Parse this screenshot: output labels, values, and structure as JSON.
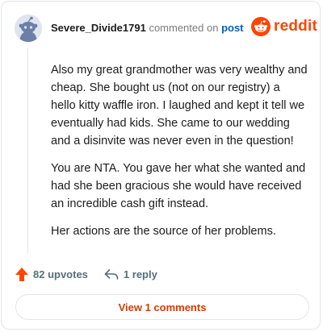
{
  "comment": {
    "username": "Severe_Divide1791",
    "commented_text": "commented on",
    "post_link": "post",
    "paragraphs": [
      "Also my great grandmother was very wealthy and cheap. She bought us (not on our registry) a hello kitty waffle iron. I laughed and kept it tell we eventually had kids. She came to our wedding and a disinvite was never even in the question!",
      "You are NTA. You gave her what she wanted and had she been gracious she would have received an incredible cash gift instead.",
      "Her actions are the source of her problems."
    ]
  },
  "brand": {
    "name": "reddit",
    "color": "#ff4500"
  },
  "actions": {
    "upvotes": "82 upvotes",
    "replies": "1 reply"
  },
  "view_button": {
    "label": "View 1 comments"
  },
  "icons": {
    "avatar": "snoo-avatar-icon",
    "logo": "reddit-snoo-icon",
    "upvote": "upvote-arrow-icon",
    "reply": "reply-arrow-icon"
  }
}
